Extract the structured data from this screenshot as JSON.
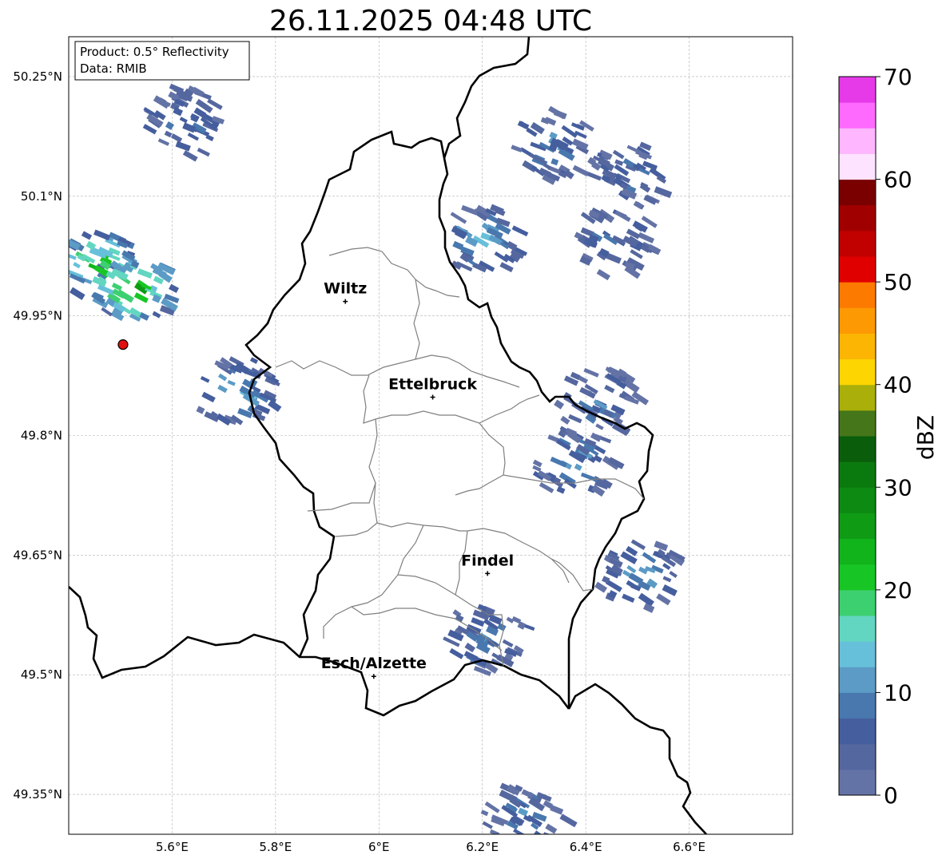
{
  "title": "26.11.2025 04:48 UTC",
  "info_box": {
    "product": "Product: 0.5° Reflectivity",
    "data": "Data: RMIB"
  },
  "axes": {
    "x_ticks": [
      {
        "lon": 5.6,
        "label": "5.6°E"
      },
      {
        "lon": 5.8,
        "label": "5.8°E"
      },
      {
        "lon": 6.0,
        "label": "6°E"
      },
      {
        "lon": 6.2,
        "label": "6.2°E"
      },
      {
        "lon": 6.4,
        "label": "6.4°E"
      },
      {
        "lon": 6.6,
        "label": "6.6°E"
      }
    ],
    "y_ticks": [
      {
        "lat": 50.25,
        "label": "50.25°N"
      },
      {
        "lat": 50.1,
        "label": "50.1°N"
      },
      {
        "lat": 49.95,
        "label": "49.95°N"
      },
      {
        "lat": 49.8,
        "label": "49.8°N"
      },
      {
        "lat": 49.65,
        "label": "49.65°N"
      },
      {
        "lat": 49.5,
        "label": "49.5°N"
      },
      {
        "lat": 49.35,
        "label": "49.35°N"
      }
    ],
    "lon_range": [
      5.4,
      6.8
    ],
    "lat_range": [
      49.3,
      50.3
    ],
    "grid": true
  },
  "cities": [
    {
      "name": "Wiltz",
      "lon": 5.935,
      "lat": 49.968
    },
    {
      "name": "Ettelbruck",
      "lon": 6.104,
      "lat": 49.848
    },
    {
      "name": "Findel",
      "lon": 6.21,
      "lat": 49.627
    },
    {
      "name": "Esch/Alzette",
      "lon": 5.99,
      "lat": 49.498
    }
  ],
  "radar_site": {
    "lon": 5.505,
    "lat": 49.914
  },
  "colorbar": {
    "label": "dBZ",
    "min": 0,
    "max": 70,
    "ticks": [
      "0",
      "10",
      "20",
      "30",
      "40",
      "50",
      "60",
      "70"
    ],
    "colors": [
      "#6473a6",
      "#55679f",
      "#455e9e",
      "#4878ae",
      "#5b9bc6",
      "#67c0da",
      "#62d6c0",
      "#3dd070",
      "#17c624",
      "#11b41b",
      "#109b15",
      "#0d8a11",
      "#0b7a0e",
      "#0a5e0b",
      "#457619",
      "#aaaf0a",
      "#fdd500",
      "#fcb503",
      "#fd9903",
      "#fd7a00",
      "#e10000",
      "#c10000",
      "#a10000",
      "#7a0000",
      "#fde3ff",
      "#feb6fe",
      "#fd6afd",
      "#e63ae8"
    ]
  },
  "chart_data": {
    "type": "heatmap",
    "title": "26.11.2025 04:48 UTC",
    "xlabel": "",
    "ylabel": "",
    "x_range": [
      5.4,
      6.8
    ],
    "y_range": [
      49.3,
      50.3
    ],
    "colorbar_label": "dBZ",
    "colorbar_range": [
      0,
      70
    ],
    "echo_regions": [
      {
        "lon": 5.52,
        "lat": 49.99,
        "dbz": 28
      },
      {
        "lon": 5.45,
        "lat": 50.02,
        "dbz": 25
      },
      {
        "lon": 5.62,
        "lat": 50.2,
        "dbz": 10
      },
      {
        "lon": 5.72,
        "lat": 49.86,
        "dbz": 14
      },
      {
        "lon": 6.19,
        "lat": 50.05,
        "dbz": 14
      },
      {
        "lon": 6.42,
        "lat": 49.85,
        "dbz": 9
      },
      {
        "lon": 6.37,
        "lat": 49.77,
        "dbz": 12
      },
      {
        "lon": 6.48,
        "lat": 50.13,
        "dbz": 8
      },
      {
        "lon": 6.45,
        "lat": 50.05,
        "dbz": 8
      },
      {
        "lon": 6.2,
        "lat": 49.55,
        "dbz": 10
      },
      {
        "lon": 6.28,
        "lat": 49.33,
        "dbz": 9
      },
      {
        "lon": 6.33,
        "lat": 50.17,
        "dbz": 10
      },
      {
        "lon": 6.5,
        "lat": 49.63,
        "dbz": 12
      }
    ]
  }
}
